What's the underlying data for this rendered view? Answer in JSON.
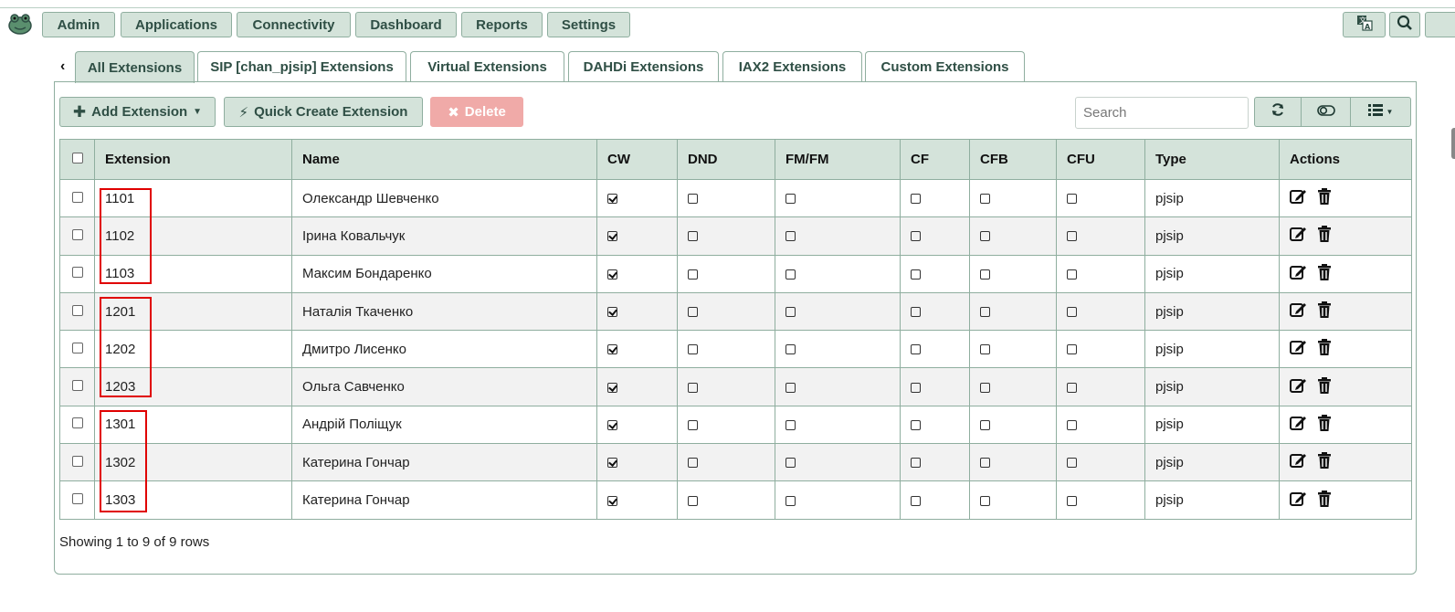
{
  "nav": {
    "items": [
      "Admin",
      "Applications",
      "Connectivity",
      "Dashboard",
      "Reports",
      "Settings"
    ],
    "icons": [
      "language-icon",
      "search-icon"
    ]
  },
  "tabs": [
    "All Extensions",
    "SIP [chan_pjsip] Extensions",
    "Virtual Extensions",
    "DAHDi Extensions",
    "IAX2 Extensions",
    "Custom Extensions"
  ],
  "toolbar": {
    "add": "Add Extension",
    "quick": "Quick Create Extension",
    "delete": "Delete",
    "search_placeholder": "Search"
  },
  "table": {
    "columns": [
      "Extension",
      "Name",
      "CW",
      "DND",
      "FM/FM",
      "CF",
      "CFB",
      "CFU",
      "Type",
      "Actions"
    ],
    "rows": [
      {
        "ext": "1101",
        "name": "Олександр Шевченко",
        "cw": true,
        "type": "pjsip"
      },
      {
        "ext": "1102",
        "name": "Ірина Ковальчук",
        "cw": true,
        "type": "pjsip"
      },
      {
        "ext": "1103",
        "name": "Максим Бондаренко",
        "cw": true,
        "type": "pjsip"
      },
      {
        "ext": "1201",
        "name": "Наталія Ткаченко",
        "cw": true,
        "type": "pjsip"
      },
      {
        "ext": "1202",
        "name": "Дмитро Лисенко",
        "cw": true,
        "type": "pjsip"
      },
      {
        "ext": "1203",
        "name": "Ольга Савченко",
        "cw": true,
        "type": "pjsip"
      },
      {
        "ext": "1301",
        "name": "Андрій Поліщук",
        "cw": true,
        "type": "pjsip"
      },
      {
        "ext": "1302",
        "name": "Катерина Гончар",
        "cw": true,
        "type": "pjsip"
      },
      {
        "ext": "1303",
        "name": "Катерина Гончар",
        "cw": true,
        "type": "pjsip"
      }
    ]
  },
  "footer": {
    "showing": "Showing 1 to 9 of 9 rows"
  },
  "colors": {
    "accent_bg": "#d4e3da",
    "accent_border": "#8fae9f",
    "text_dark_green": "#2f4f45",
    "danger": "#f0aaa8",
    "highlight": "#e00000"
  }
}
